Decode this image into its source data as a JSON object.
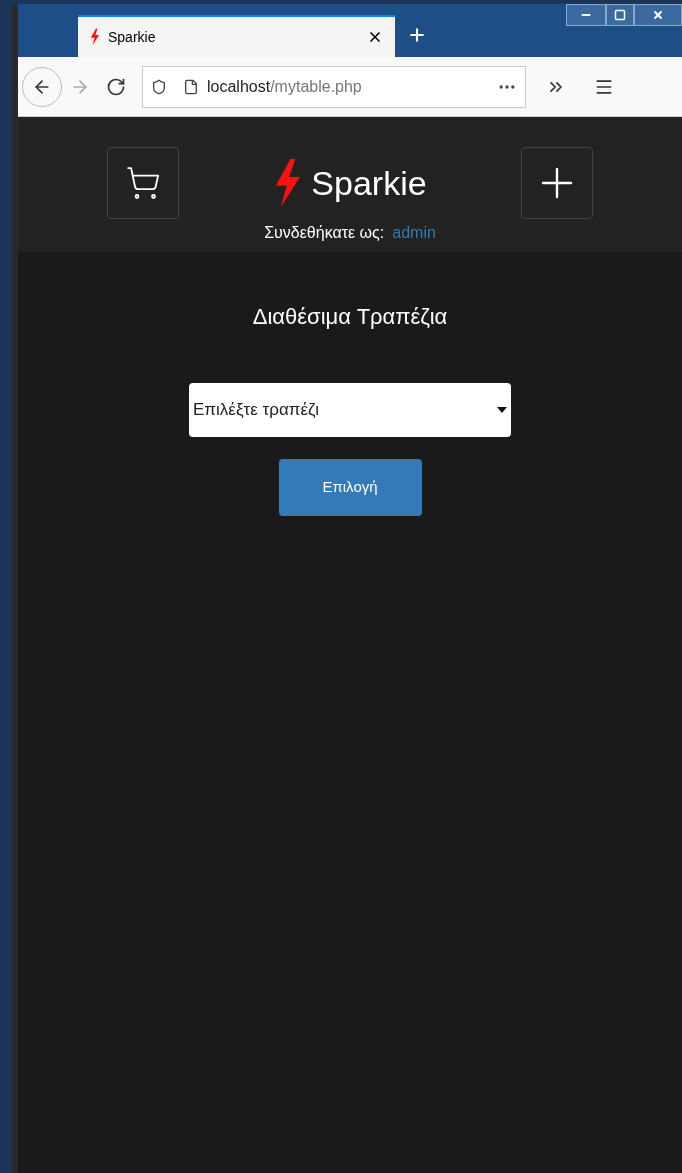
{
  "browser": {
    "tabs": [
      {
        "title": "Sparkie",
        "selected": true
      }
    ],
    "url": {
      "host": "localhost",
      "path": "/mytable.php"
    }
  },
  "header": {
    "brand": "Sparkie",
    "logged_in_label": "Συνδεθήκατε ως:",
    "user": "admin"
  },
  "main": {
    "title": "Διαθέσιμα Τραπέζια",
    "select": {
      "value": "Επιλέξτε τραπέζι"
    },
    "button": "Επιλογή"
  }
}
